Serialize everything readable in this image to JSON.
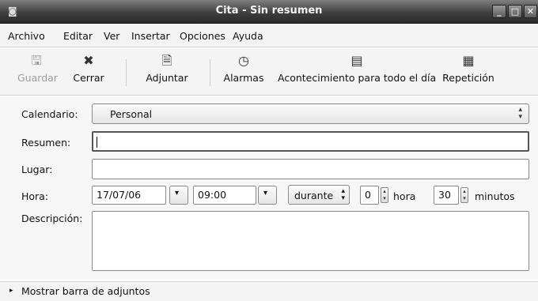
{
  "window": {
    "title": "Cita - Sin resumen",
    "app_icon": "calendar-app-icon"
  },
  "menu": {
    "items": [
      "Archivo",
      "Editar",
      "Ver",
      "Insertar",
      "Opciones",
      "Ayuda"
    ]
  },
  "toolbar": {
    "guardar": "Guardar",
    "cerrar": "Cerrar",
    "adjuntar": "Adjuntar",
    "alarmas": "Alarmas",
    "acontecimiento": "Acontecimiento para todo el día",
    "repeticion": "Repetición"
  },
  "form": {
    "calendario_label": "Calendario:",
    "calendario_value": "Personal",
    "resumen_label": "Resumen:",
    "resumen_value": "",
    "lugar_label": "Lugar:",
    "lugar_value": "",
    "hora_label": "Hora:",
    "fecha": "17/07/06",
    "hora": "09:00",
    "duracion_mode": "durante",
    "horas": "0",
    "hora_unit": "hora",
    "minutos": "30",
    "minutos_unit": "minutos",
    "descripcion_label": "Descripción:",
    "descripcion_value": ""
  },
  "footer": {
    "toggle": "Mostrar barra de adjuntos"
  }
}
